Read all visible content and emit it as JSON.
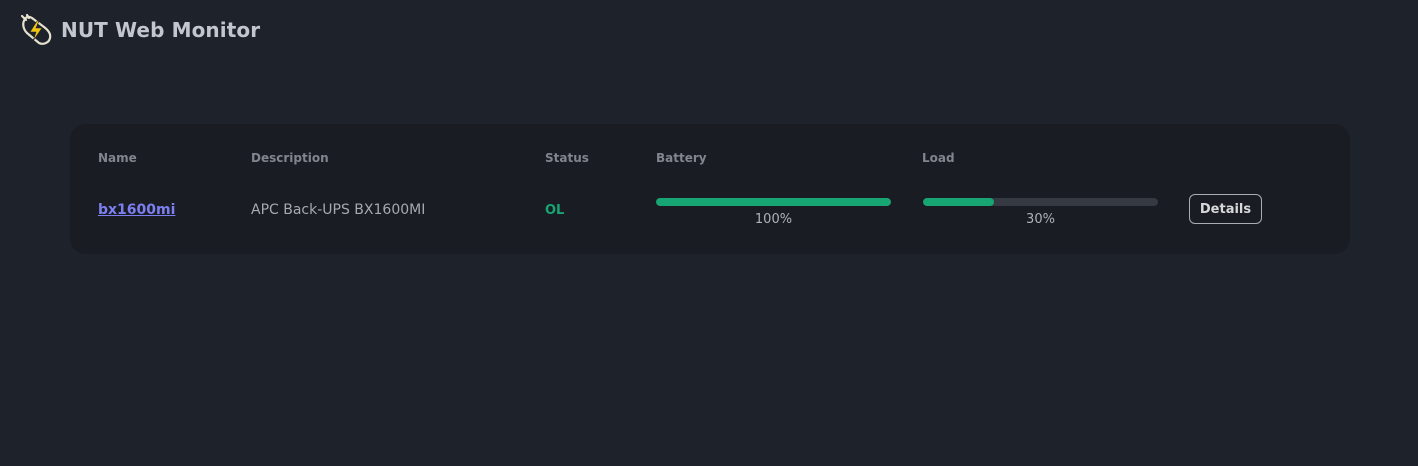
{
  "app": {
    "title": "NUT Web Monitor",
    "logo_icon": "plug-bolt-icon"
  },
  "table": {
    "headers": {
      "name": "Name",
      "description": "Description",
      "status": "Status",
      "battery": "Battery",
      "load": "Load"
    },
    "rows": [
      {
        "name": "bx1600mi",
        "description": "APC Back-UPS BX1600MI",
        "status": "OL",
        "battery_percent": 100,
        "battery_label": "100%",
        "load_percent": 30,
        "load_label": "30%",
        "details_label": "Details"
      }
    ]
  },
  "colors": {
    "background": "#1e222a",
    "card": "#191c22",
    "accent_link": "#7c7ff0",
    "status_ok": "#17a673",
    "bar_fill": "#17a673",
    "bar_track": "#353941"
  }
}
